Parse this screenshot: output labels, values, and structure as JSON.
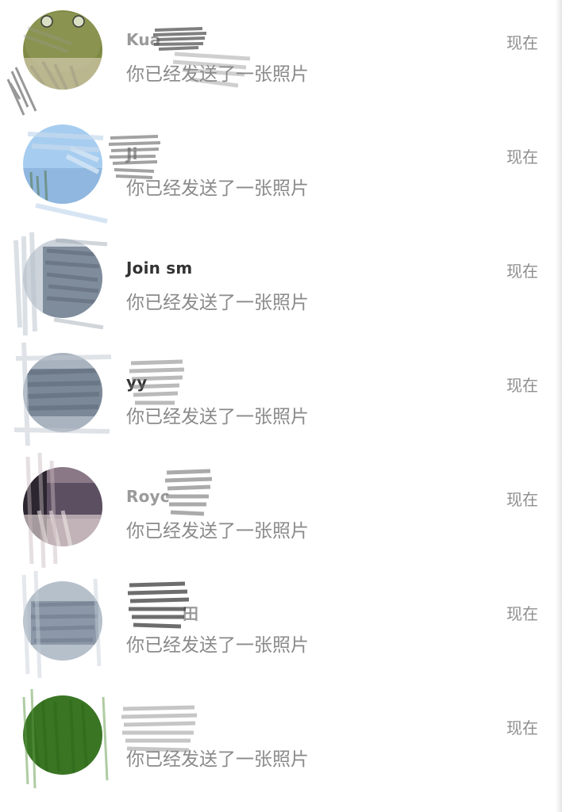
{
  "conversations": [
    {
      "name": "Kua",
      "message": "你已经发送了一张照片",
      "time": "现在",
      "avatar_color": "#7e8a45"
    },
    {
      "name": "Ji",
      "message": "你已经发送了一张照片",
      "time": "现在",
      "avatar_color": "#9cc7ee"
    },
    {
      "name": "Join sm",
      "message": "你已经发送了一张照片",
      "time": "现在",
      "avatar_color": "#8391a2"
    },
    {
      "name": "yy",
      "message": "你已经发送了一张照片",
      "time": "现在",
      "avatar_color": "#7b8898"
    },
    {
      "name": "Royc",
      "message": "你已经发送了一张照片",
      "time": "现在",
      "avatar_color": "#7f6b7a"
    },
    {
      "name": "田",
      "message": "你已经发送了一张照片",
      "time": "现在",
      "avatar_color": "#8c98a8"
    },
    {
      "name": "",
      "message": "你已经发送了一张照片",
      "time": "现在",
      "avatar_color": "#3a7524"
    }
  ]
}
